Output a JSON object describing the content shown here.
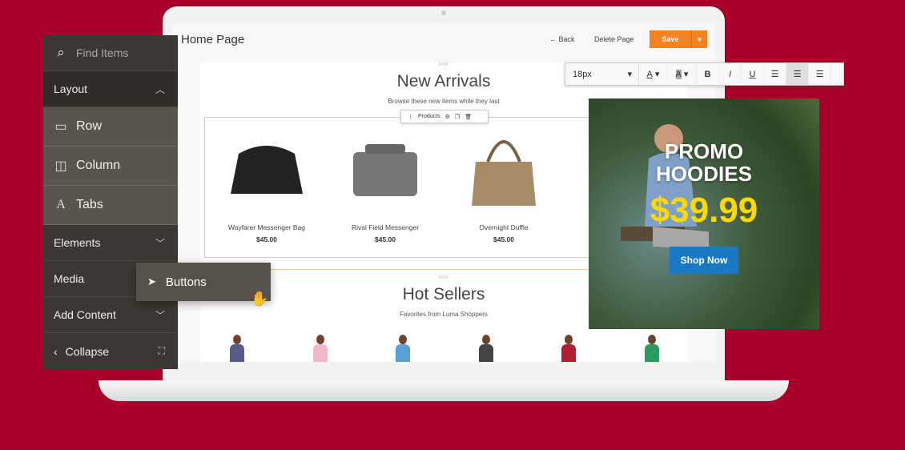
{
  "header": {
    "title": "Home Page",
    "back": "← Back",
    "delete": "Delete Page",
    "save": "Save"
  },
  "sections": [
    {
      "row_label": "ROW",
      "title": "New Arrivals",
      "subtitle": "Browse these new items while they last"
    },
    {
      "row_label": "ROW",
      "title": "Hot Sellers",
      "subtitle": "Favorites from Luma Shoppers"
    }
  ],
  "products_toolbar": {
    "label": "Products"
  },
  "products": [
    {
      "name": "Wayfarer Messenger Bag",
      "price": "$45.00",
      "color": "#222"
    },
    {
      "name": "Rival Field Messenger",
      "price": "$45.00",
      "color": "#777"
    },
    {
      "name": "Overnight Duffle",
      "price": "$45.00",
      "color": "#a58c66"
    }
  ],
  "people_colors": [
    "#5a5a8a",
    "#f0b8c8",
    "#5aa0d8",
    "#444",
    "#b02030",
    "#2a9a60"
  ],
  "sidebar": {
    "search_placeholder": "Find Items",
    "layout": "Layout",
    "row": "Row",
    "column": "Column",
    "tabs": "Tabs",
    "elements": "Elements",
    "media": "Media",
    "add_content": "Add Content",
    "collapse": "Collapse"
  },
  "drag_item": {
    "label": "Buttons"
  },
  "editor_toolbar": {
    "font_size": "18px",
    "bold": "B",
    "italic": "I",
    "underline": "U",
    "font_color": "A",
    "highlight": "A"
  },
  "promo": {
    "line1": "PROMO",
    "line2": "HOODIES",
    "price": "$39.99",
    "cta": "Shop Now"
  },
  "colors": {
    "background": "#a8002a",
    "save": "#f58220",
    "cta": "#1979c3",
    "price": "#ffd800"
  }
}
